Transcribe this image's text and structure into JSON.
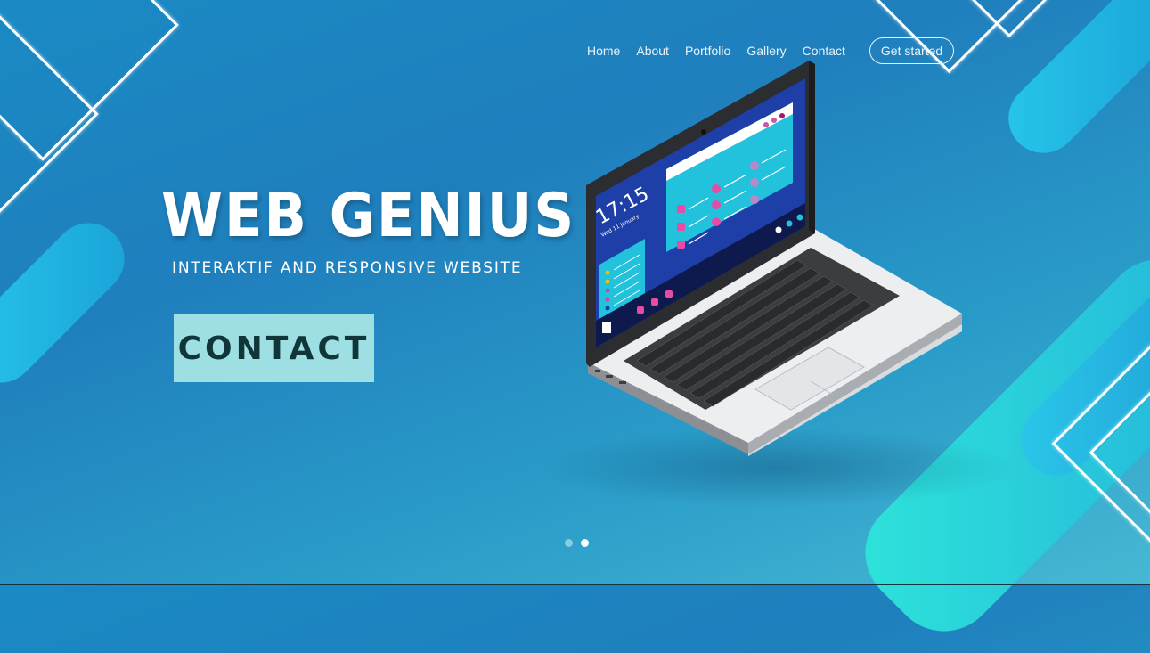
{
  "nav": {
    "links": [
      "Home",
      "About",
      "Portfolio",
      "Gallery",
      "Contact"
    ],
    "cta": "Get started"
  },
  "hero": {
    "title": "WEB GENIUS",
    "subtitle": "INTERAKTIF AND RESPONSIVE WEBSITE",
    "button": "CONTACT"
  },
  "laptop_screen": {
    "time": "17:15",
    "date": "Wed 11 January"
  },
  "carousel": {
    "dots": 2,
    "active_index": 1
  },
  "colors": {
    "bg_primary": "#1f7fbd",
    "accent_cyan": "#27c6ea",
    "button_bg": "#9ddfe2",
    "button_text": "#11363a"
  }
}
